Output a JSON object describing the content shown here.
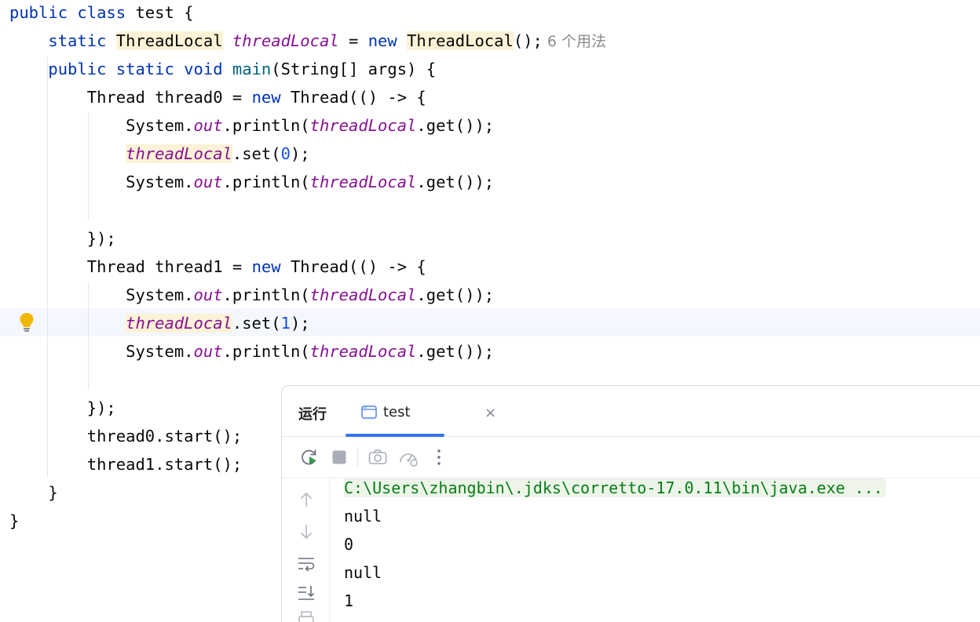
{
  "editor": {
    "code": {
      "l1": {
        "kw": "public class",
        "name": "test {"
      },
      "l2": {
        "kw1": "static",
        "type": "ThreadLocal",
        "field": "threadLocal",
        "eq": " = ",
        "kw2": "new",
        "type2": "ThreadLocal",
        "rest": "();",
        "hint": "6 个用法"
      },
      "l3": {
        "kw": "public static void",
        "method": "main",
        "rest": "(String[] args) {"
      },
      "l4": {
        "type": "Thread thread0 = ",
        "kw": "new",
        "rest": " Thread(() -> {"
      },
      "l5": {
        "a": "System.",
        "b": "out",
        "c": ".println(",
        "d": "threadLocal",
        "e": ".get());"
      },
      "l6": {
        "a": "threadLocal",
        "b": ".set(",
        "c": "0",
        "d": ");"
      },
      "l7": {
        "a": "System.",
        "b": "out",
        "c": ".println(",
        "d": "threadLocal",
        "e": ".get());"
      },
      "l9": "});",
      "l10": {
        "type": "Thread thread1 = ",
        "kw": "new",
        "rest": " Thread(() -> {"
      },
      "l11": {
        "a": "System.",
        "b": "out",
        "c": ".println(",
        "d": "threadLocal",
        "e": ".get());"
      },
      "l12": {
        "a": "threadLocal",
        "b": ".set(",
        "c": "1",
        "d": ");"
      },
      "l13": {
        "a": "System.",
        "b": "out",
        "c": ".println(",
        "d": "threadLocal",
        "e": ".get());"
      },
      "l15": "});",
      "l16": "thread0.start();",
      "l17": "thread1.start();",
      "l18": "}",
      "l19": "}"
    },
    "intention_icon": "lightbulb-icon"
  },
  "run_panel": {
    "title": "运行",
    "tab": {
      "label": "test",
      "icon": "console-window-icon",
      "close": "×"
    },
    "toolbar_icons": [
      "rerun-icon",
      "stop-icon",
      "camera-icon",
      "gauge-icon",
      "more-vertical-icon"
    ],
    "gutter_icons": [
      "arrow-up-icon",
      "arrow-down-icon",
      "soft-wrap-icon",
      "scroll-to-end-icon",
      "print-icon"
    ],
    "output": {
      "command": "C:\\Users\\zhangbin\\.jdks\\corretto-17.0.11\\bin\\java.exe ...",
      "lines": [
        "null",
        "0",
        "null",
        "1"
      ]
    },
    "accent_color": "#3574f0"
  }
}
